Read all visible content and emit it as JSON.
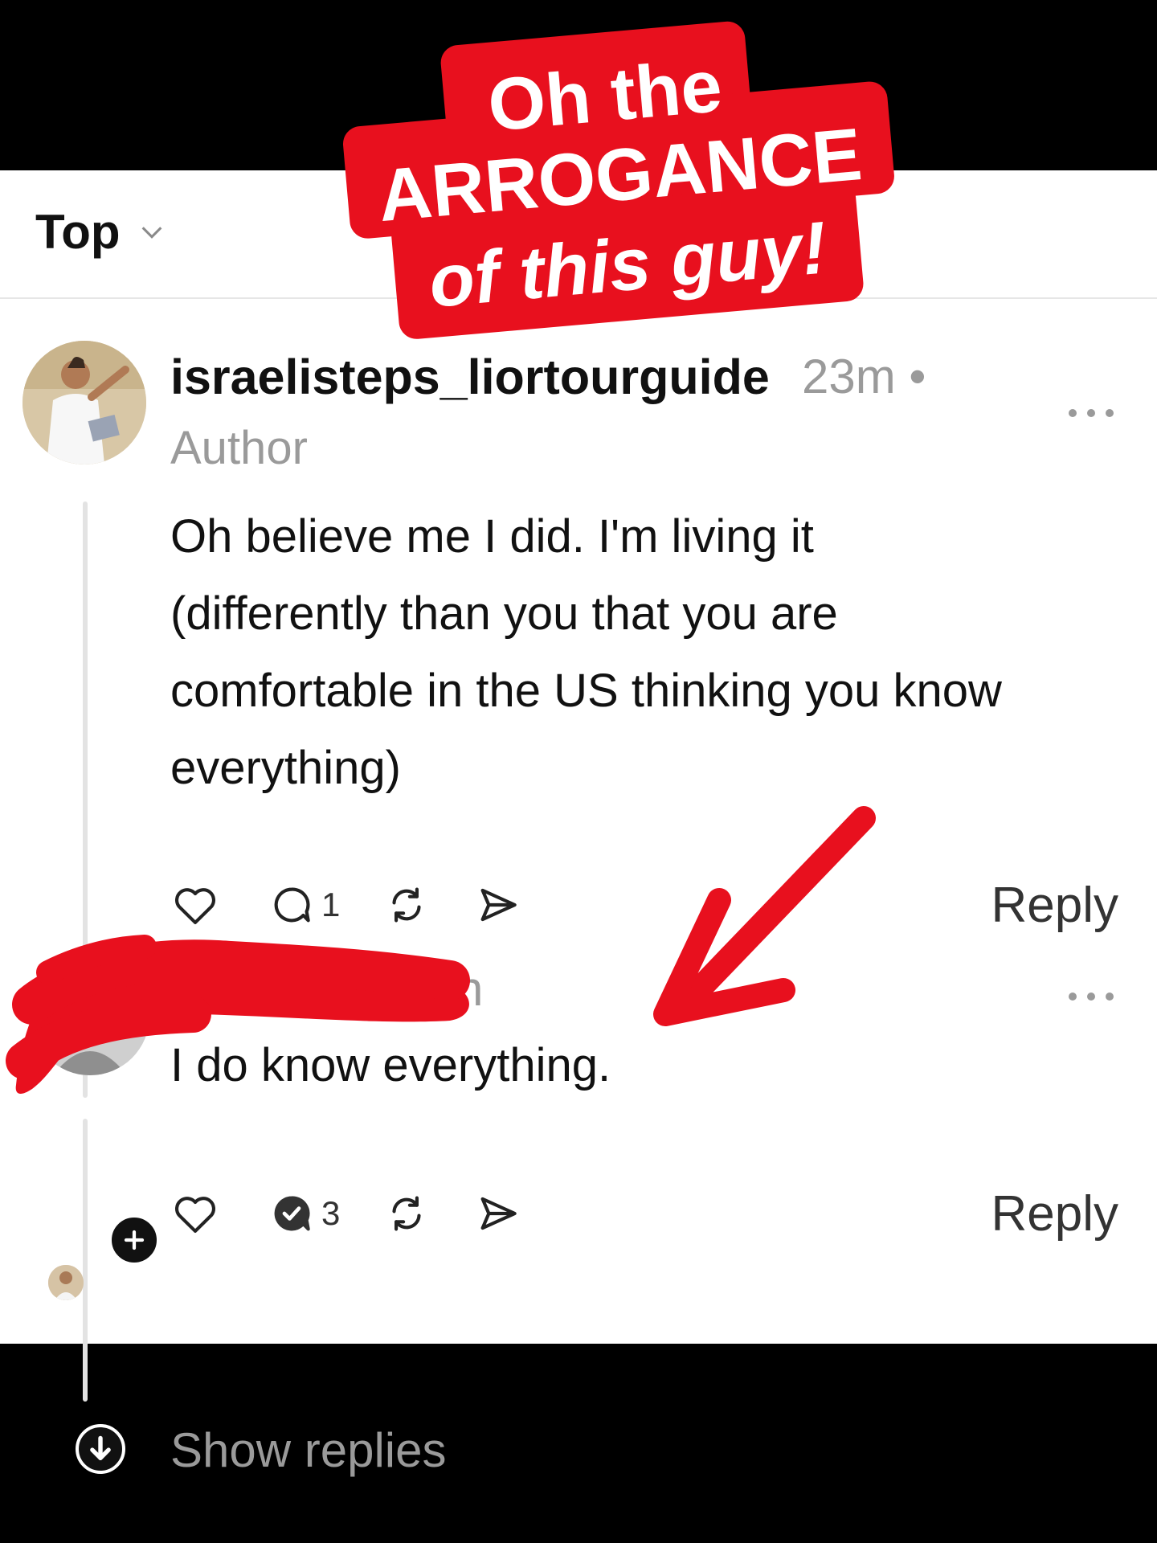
{
  "sort": {
    "label": "Top"
  },
  "overlay": {
    "lines": [
      "Oh the",
      "ARROGANCE",
      "of this guy!"
    ],
    "color": "#e8101e"
  },
  "comment1": {
    "username": "israelisteps_liortourguide",
    "time": "23m •",
    "badge": "Author",
    "text": "Oh believe me I did. I'm living it (differently than you that you are comfortable in the US thinking you know everything)",
    "reply_count": "1",
    "reply_label": "Reply"
  },
  "comment2": {
    "time_partial": "n",
    "text": "I do know everything.",
    "reply_count": "3",
    "reply_label": "Reply"
  },
  "show_replies": "Show replies",
  "icons": [
    "chevron-down-icon",
    "more-icon",
    "heart-icon",
    "comment-icon",
    "repost-icon",
    "share-icon",
    "plus-icon",
    "arrow-down-icon"
  ],
  "colors": {
    "annotation_red": "#e8101e",
    "muted_text": "#9a9a9a"
  }
}
